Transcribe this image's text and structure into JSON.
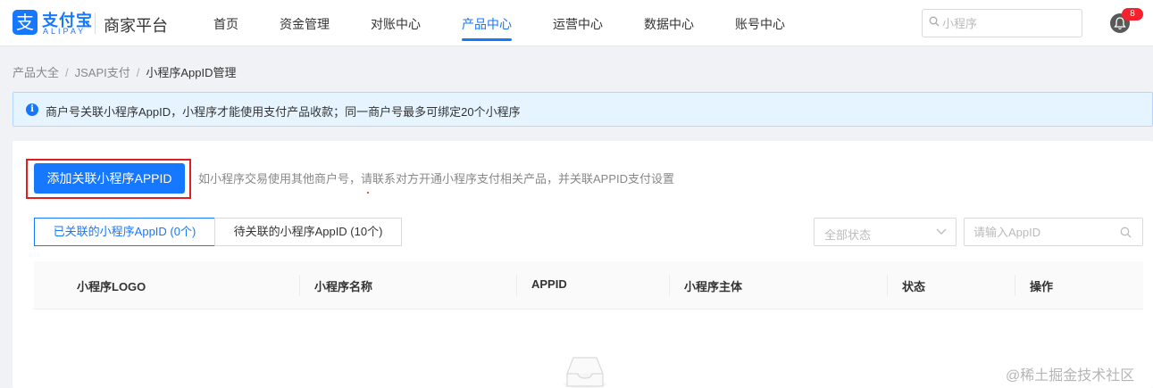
{
  "header": {
    "logo_cn": "支付宝",
    "logo_en": "ALIPAY",
    "logo_glyph": "支",
    "platform": "商家平台",
    "nav": [
      {
        "label": "首页",
        "active": false
      },
      {
        "label": "资金管理",
        "active": false
      },
      {
        "label": "对账中心",
        "active": false
      },
      {
        "label": "产品中心",
        "active": true
      },
      {
        "label": "运营中心",
        "active": false
      },
      {
        "label": "数据中心",
        "active": false
      },
      {
        "label": "账号中心",
        "active": false
      }
    ],
    "search_placeholder": "小程序",
    "notification_count": "8"
  },
  "breadcrumb": {
    "items": [
      "产品大全",
      "JSAPI支付",
      "小程序AppID管理"
    ],
    "separator": "/"
  },
  "alert": {
    "icon": "info-icon",
    "message": "商户号关联小程序AppID，小程序才能使用支付产品收款；同一商户号最多可绑定20个小程序"
  },
  "actions": {
    "add_button": "添加关联小程序APPID",
    "tip": "如小程序交易使用其他商户号，请联系对方开通小程序支付相关产品，并关联APPID支付设置"
  },
  "tabs": [
    {
      "label": "已关联的小程序AppID (0个)",
      "active": true
    },
    {
      "label": "待关联的小程序AppID (10个)",
      "active": false
    }
  ],
  "filters": {
    "status_select": "全部状态",
    "appid_placeholder": "请输入AppID"
  },
  "table": {
    "columns": [
      "小程序LOGO",
      "小程序名称",
      "APPID",
      "小程序主体",
      "状态",
      "操作"
    ]
  },
  "watermark": "@稀土掘金技术社区",
  "colors": {
    "primary": "#1677ff",
    "highlight_outline": "#e02020",
    "alert_bg": "#e6f4ff",
    "badge": "#f5222d"
  }
}
